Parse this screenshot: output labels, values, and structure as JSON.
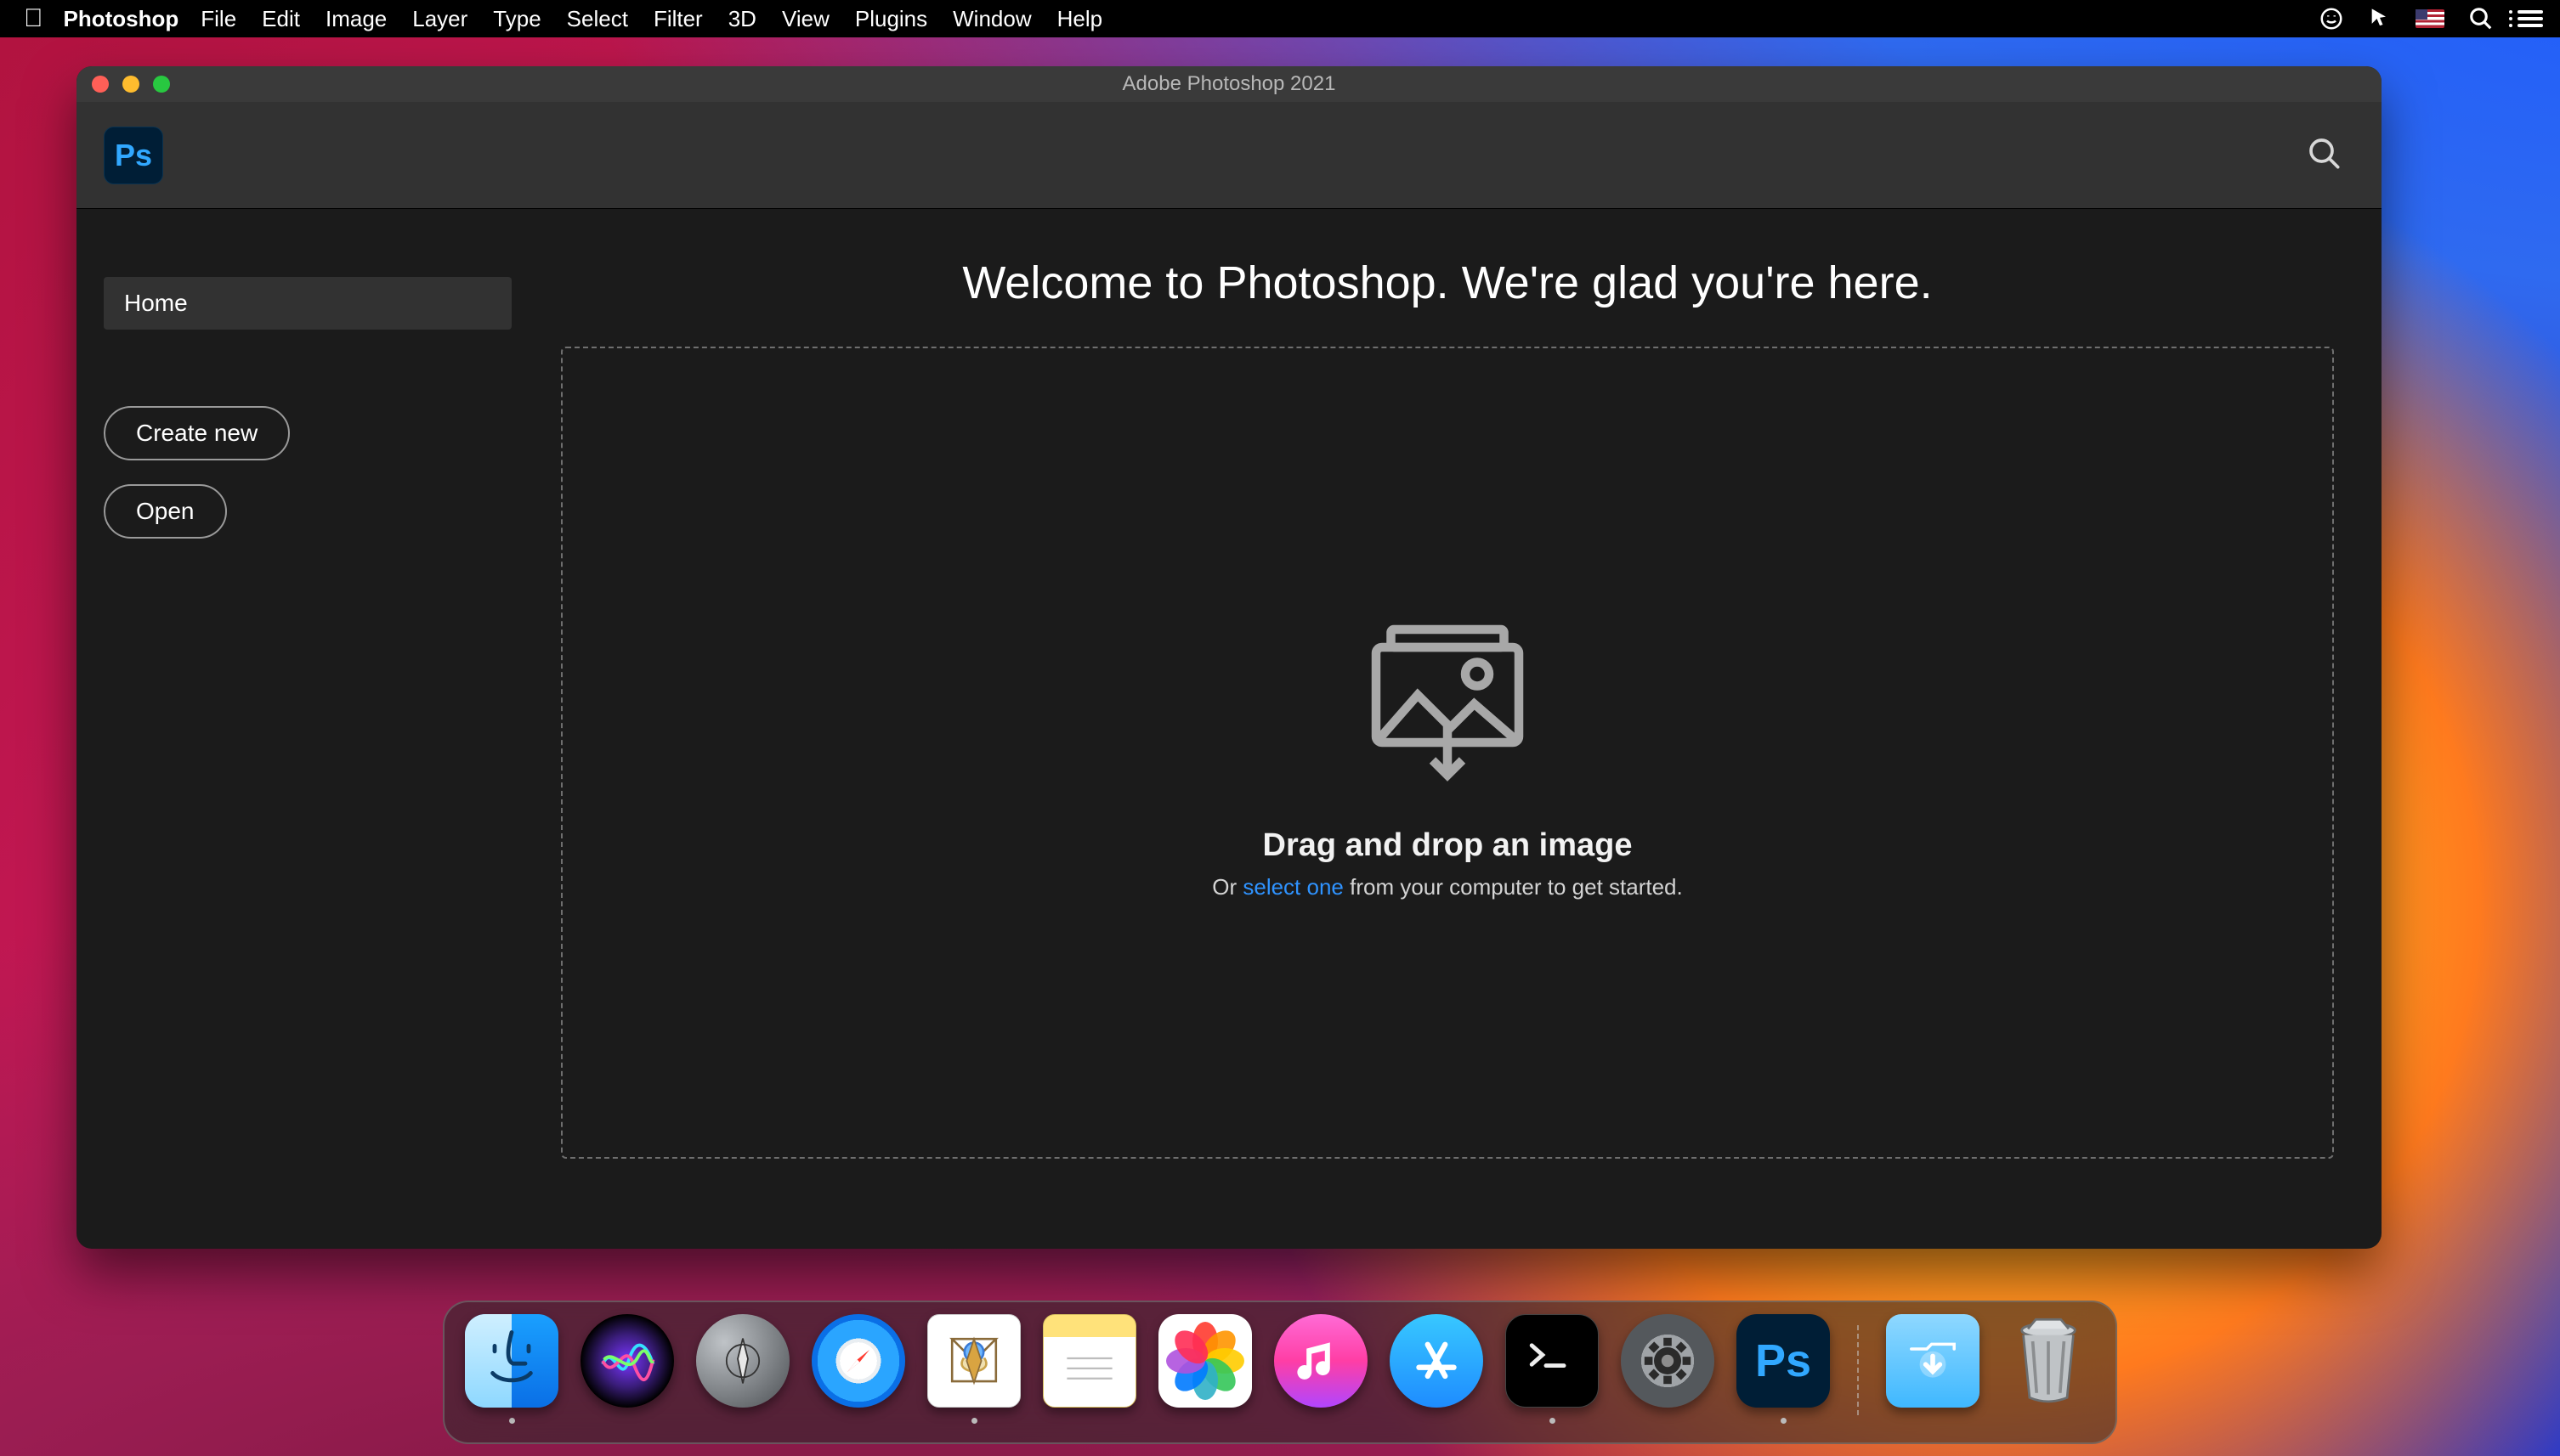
{
  "menubar": {
    "app_name": "Photoshop",
    "items": [
      "File",
      "Edit",
      "Image",
      "Layer",
      "Type",
      "Select",
      "Filter",
      "3D",
      "View",
      "Plugins",
      "Window",
      "Help"
    ]
  },
  "window": {
    "title": "Adobe Photoshop 2021",
    "logo_text": "Ps"
  },
  "sidebar": {
    "home_tab": "Home",
    "create_button": "Create new",
    "open_button": "Open"
  },
  "home": {
    "welcome": "Welcome to Photoshop. We're glad you're here.",
    "drop_heading": "Drag and drop an image",
    "drop_prefix": "Or ",
    "drop_link": "select one",
    "drop_suffix": " from your computer to get started."
  },
  "dock": {
    "items": [
      {
        "name": "finder",
        "running": true
      },
      {
        "name": "siri",
        "running": false
      },
      {
        "name": "launchpad",
        "running": false
      },
      {
        "name": "safari",
        "running": false
      },
      {
        "name": "mail",
        "running": true
      },
      {
        "name": "notes",
        "running": false
      },
      {
        "name": "photos",
        "running": false
      },
      {
        "name": "music",
        "running": false
      },
      {
        "name": "appstore",
        "running": false
      },
      {
        "name": "terminal",
        "running": true
      },
      {
        "name": "system-preferences",
        "running": false
      },
      {
        "name": "photoshop",
        "running": true
      }
    ],
    "right_items": [
      {
        "name": "downloads"
      },
      {
        "name": "trash"
      }
    ]
  }
}
